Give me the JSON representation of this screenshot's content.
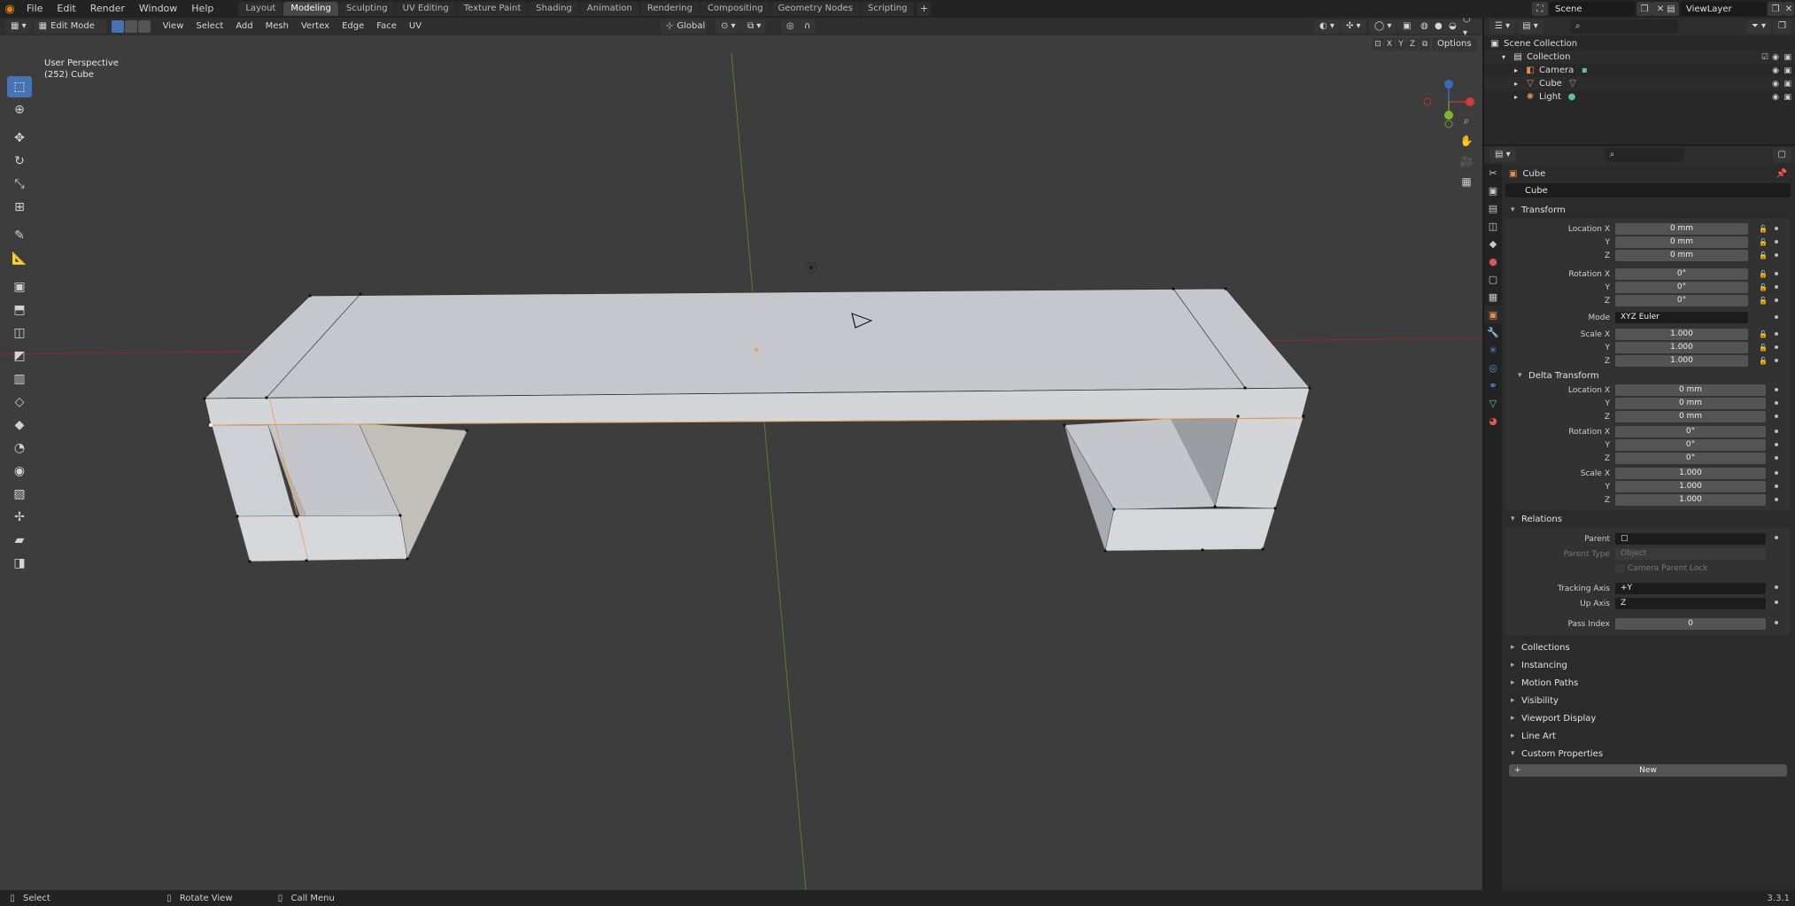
{
  "app": {
    "menus": [
      "File",
      "Edit",
      "Render",
      "Window",
      "Help"
    ],
    "workspaces": [
      "Layout",
      "Modeling",
      "Sculpting",
      "UV Editing",
      "Texture Paint",
      "Shading",
      "Animation",
      "Rendering",
      "Compositing",
      "Geometry Nodes",
      "Scripting"
    ],
    "active_workspace": "Modeling",
    "add_tab": "+",
    "scene": "Scene",
    "view_layer": "ViewLayer",
    "version": "3.3.1"
  },
  "viewport": {
    "mode": "Edit Mode",
    "menus": [
      "View",
      "Select",
      "Add",
      "Mesh",
      "Vertex",
      "Edge",
      "Face",
      "UV"
    ],
    "orientation": "Global",
    "perspective_label": "User Perspective",
    "object_label": "(252) Cube",
    "options_label": "Options",
    "axis_x": "X",
    "axis_y": "Y",
    "axis_z": "Z",
    "colors": {
      "background": "#3d3d3d",
      "mesh_top": "#c5c7cc",
      "mesh_front": "#d3d5d9",
      "x_axis": "#8b2d2d",
      "y_axis": "#5f7a2c",
      "selected_edge": "#e8a050"
    }
  },
  "outliner": {
    "root": "Scene Collection",
    "collection": "Collection",
    "items": [
      {
        "name": "Camera",
        "icon": "camera-icon"
      },
      {
        "name": "Cube",
        "icon": "mesh-icon"
      },
      {
        "name": "Light",
        "icon": "light-icon"
      }
    ]
  },
  "properties": {
    "object_name": "Cube",
    "object_field": "Cube",
    "transform": {
      "title": "Transform",
      "location_label": "Location X",
      "rotation_label": "Rotation X",
      "scale_label": "Scale X",
      "y_label": "Y",
      "z_label": "Z",
      "mode_label": "Mode",
      "location": [
        "0 mm",
        "0 mm",
        "0 mm"
      ],
      "rotation": [
        "0°",
        "0°",
        "0°"
      ],
      "mode": "XYZ Euler",
      "scale": [
        "1.000",
        "1.000",
        "1.000"
      ]
    },
    "delta_transform": {
      "title": "Delta Transform",
      "location": [
        "0 mm",
        "0 mm",
        "0 mm"
      ],
      "rotation": [
        "0°",
        "0°",
        "0°"
      ],
      "scale": [
        "1.000",
        "1.000",
        "1.000"
      ]
    },
    "relations": {
      "title": "Relations",
      "parent_label": "Parent",
      "parent_type_label": "Parent Type",
      "parent_type": "Object",
      "camera_parent_lock": "Camera Parent Lock",
      "tracking_axis_label": "Tracking Axis",
      "tracking_axis": "+Y",
      "up_axis_label": "Up Axis",
      "up_axis": "Z",
      "pass_index_label": "Pass Index",
      "pass_index": "0"
    },
    "collapsed_panels": [
      "Collections",
      "Instancing",
      "Motion Paths",
      "Visibility",
      "Viewport Display",
      "Line Art"
    ],
    "custom_properties": {
      "title": "Custom Properties",
      "new_label": "New"
    }
  },
  "statusbar": {
    "select": "Select",
    "rotate_view": "Rotate View",
    "call_menu": "Call Menu"
  }
}
